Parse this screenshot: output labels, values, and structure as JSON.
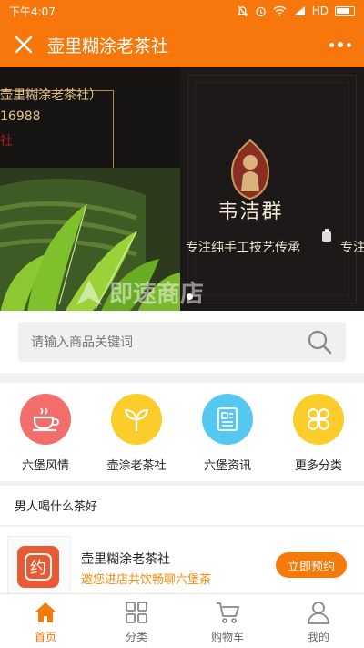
{
  "status_bar": {
    "time": "下午4:07",
    "network": "HD"
  },
  "header": {
    "title": "壶里糊涂老茶社"
  },
  "banner": {
    "left_shop_name": "壶里糊涂老茶社）",
    "left_phone": "16988",
    "left_seal": "社",
    "brand_name": "韦洁群",
    "slogan": "专注纯手工技艺传承",
    "slogan_repeat": "专注"
  },
  "watermark": {
    "text": "即速商店"
  },
  "search": {
    "placeholder": "请输入商品关键词"
  },
  "categories": [
    {
      "label": "六堡风情",
      "color": "#f36d6a",
      "icon": "tea-cup-icon"
    },
    {
      "label": "壶涂老茶社",
      "color": "#fbcd2a",
      "icon": "sprout-icon"
    },
    {
      "label": "六堡资讯",
      "color": "#55c8f0",
      "icon": "news-icon"
    },
    {
      "label": "更多分类",
      "color": "#fbcd2a",
      "icon": "grid-clover-icon"
    }
  ],
  "section": {
    "title": "男人喝什么茶好"
  },
  "shop_card": {
    "logo_char": "约",
    "name": "壶里糊涂老茶社",
    "description": "邀您进店共饮畅聊六堡茶",
    "button_label": "立即预约"
  },
  "tabs": [
    {
      "label": "首页",
      "active": true
    },
    {
      "label": "分类",
      "active": false
    },
    {
      "label": "购物车",
      "active": false
    },
    {
      "label": "我的",
      "active": false
    }
  ],
  "colors": {
    "brand": "#f7770d",
    "accent_text": "#f28e0c",
    "button": "#f47a0b"
  }
}
